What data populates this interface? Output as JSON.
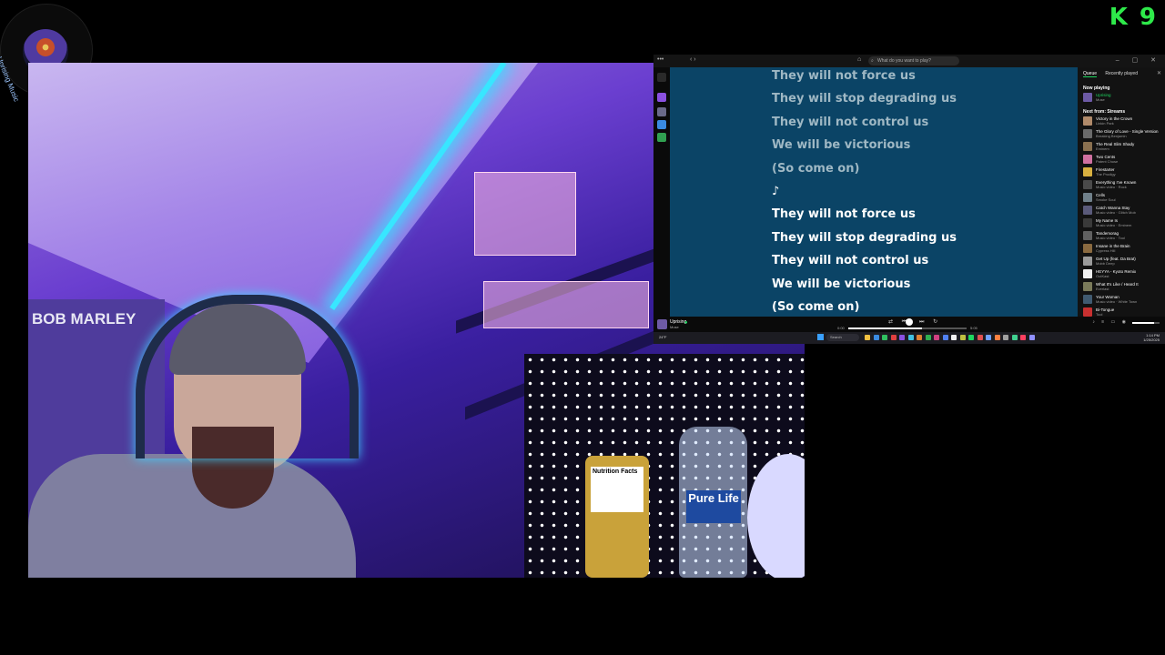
{
  "overlay": {
    "channel_name": "Uprising Music",
    "brand_badge": "K 9"
  },
  "webcam": {
    "poster_text": "BOB MARLEY",
    "bottle_label": "Pure Life",
    "can_label": "Nutrition Facts"
  },
  "spotify": {
    "search_placeholder": "What do you want to play?",
    "lyrics": [
      {
        "text": "They will not force us",
        "state": "past"
      },
      {
        "text": "They will stop degrading us",
        "state": "past"
      },
      {
        "text": "They will not control us",
        "state": "past"
      },
      {
        "text": "We will be victorious",
        "state": "past"
      },
      {
        "text": "(So come on)",
        "state": "past"
      },
      {
        "text": "♪",
        "state": "active"
      },
      {
        "text": "They will not force us",
        "state": "active"
      },
      {
        "text": "They will stop degrading us",
        "state": "active"
      },
      {
        "text": "They will not control us",
        "state": "active"
      },
      {
        "text": "We will be victorious",
        "state": "active"
      },
      {
        "text": "(So come on)",
        "state": "active"
      }
    ],
    "queue": {
      "tabs": [
        "Queue",
        "Recently played"
      ],
      "now_playing_label": "Now playing",
      "now_playing": {
        "title": "Uprising",
        "artist": "Muse"
      },
      "next_label": "Next from: Streams",
      "items": [
        {
          "title": "Victory in the Crown",
          "artist": "Linkin Park",
          "color": "#b08a6a"
        },
        {
          "title": "The Glory of Love - Single Version",
          "artist": "Breaking Benjamin",
          "color": "#6a6a6a"
        },
        {
          "title": "The Real Slim Shady",
          "artist": "Eminem",
          "color": "#8a7050"
        },
        {
          "title": "Two Cents",
          "artist": "Patent Chose",
          "color": "#d070a0"
        },
        {
          "title": "Firestarter",
          "artist": "The Prodigy",
          "color": "#d8b040"
        },
        {
          "title": "Everything I've Known",
          "artist": "Music video · Rock",
          "color": "#4a4a4a"
        },
        {
          "title": "Cells",
          "artist": "Smoke Soul",
          "color": "#70808a"
        },
        {
          "title": "Catch Wanna Stay",
          "artist": "Music video · Glitch Mob",
          "color": "#5a5a7a"
        },
        {
          "title": "My Name Is",
          "artist": "Music video · Eminem",
          "color": "#3a3a3a"
        },
        {
          "title": "Tandemorag",
          "artist": "Music video · Tool",
          "color": "#606060"
        },
        {
          "title": "Insane in the Brain",
          "artist": "Cypress Hill",
          "color": "#8a6a40"
        },
        {
          "title": "Get Up (feat. Da Brat)",
          "artist": "Mobb Deep",
          "color": "#9a9a9a"
        },
        {
          "title": "HEYYA - Kyoto Remix",
          "artist": "OutKast",
          "color": "#f0f0f0"
        },
        {
          "title": "What It's Like / Heard It",
          "artist": "Everlast",
          "color": "#7a7a5a"
        },
        {
          "title": "Your Woman",
          "artist": "Music video · White Town",
          "color": "#405a70"
        },
        {
          "title": "Bi-Tongue",
          "artist": "Tool",
          "color": "#c83030"
        }
      ]
    },
    "player": {
      "title": "Uprising",
      "artist": "Muse",
      "elapsed": "0:00",
      "total": "5:05",
      "progress": 0.62,
      "volume": 0.8
    }
  },
  "taskbar": {
    "weather": "24°F",
    "search": "Search",
    "time": "1:14 PM",
    "date": "1/25/2025",
    "icon_colors": [
      "#f0c040",
      "#3a8ae0",
      "#30c060",
      "#e04040",
      "#8a50e0",
      "#40c0e0",
      "#e08030",
      "#30b050",
      "#d04080",
      "#5080f0",
      "#f0f0f0",
      "#c0c040",
      "#1ed760",
      "#e05050",
      "#70a0ff",
      "#ff8040",
      "#a0a0a0",
      "#40d090",
      "#ff4060",
      "#9090ff"
    ]
  }
}
